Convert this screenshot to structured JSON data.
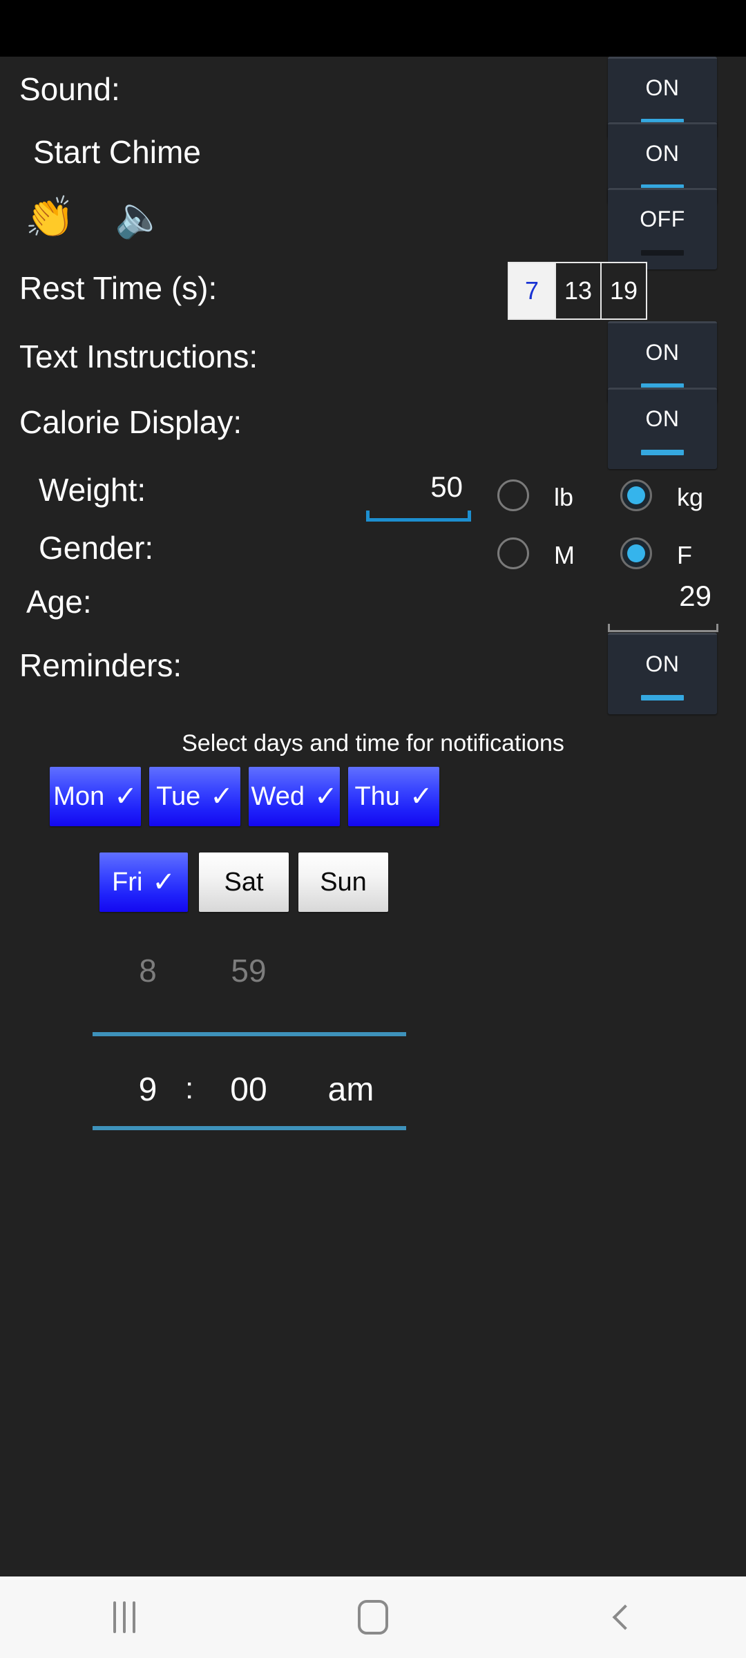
{
  "status_bar": {
    "background": "#000000"
  },
  "theme": {
    "background": "#222222",
    "accent_cyan": "#35a8e0",
    "accent_blue": "#1a34d4",
    "day_selected_blue": "#2a31fb",
    "text": "#ffffff"
  },
  "settings": {
    "sound": {
      "label": "Sound:",
      "toggle": "ON",
      "state": "on"
    },
    "start_chime": {
      "label": "Start Chime",
      "toggle": "ON",
      "state": "on"
    },
    "clap_sound": {
      "clap_icon": "clapping-hands-icon",
      "speaker_icon": "speaker-wave-icon",
      "toggle": "OFF",
      "state": "off"
    },
    "rest_time": {
      "label": "Rest Time (s):",
      "options": [
        "7",
        "13",
        "19"
      ],
      "selected": "7",
      "selected_index": 0
    },
    "text_instructions": {
      "label": "Text Instructions:",
      "toggle": "ON",
      "state": "on"
    },
    "calorie_display": {
      "label": "Calorie Display:",
      "toggle": "ON",
      "state": "on"
    },
    "weight": {
      "label": "Weight:",
      "value": "50",
      "placeholder": "0",
      "units": [
        {
          "label": "lb",
          "checked": false
        },
        {
          "label": "kg",
          "checked": true
        }
      ]
    },
    "gender": {
      "label": "Gender:",
      "options": [
        {
          "label": "M",
          "checked": false
        },
        {
          "label": "F",
          "checked": true
        }
      ]
    },
    "age": {
      "label": "Age:",
      "value": "29",
      "placeholder": "0"
    },
    "reminders": {
      "label": "Reminders:",
      "toggle": "ON",
      "state": "on",
      "hint": "Select days and time for notifications",
      "check_glyph": "✓",
      "days": [
        {
          "label": "Mon",
          "selected": true
        },
        {
          "label": "Tue",
          "selected": true
        },
        {
          "label": "Wed",
          "selected": true
        },
        {
          "label": "Thu",
          "selected": true
        },
        {
          "label": "Fri",
          "selected": true
        },
        {
          "label": "Sat",
          "selected": false
        },
        {
          "label": "Sun",
          "selected": false
        }
      ],
      "time": {
        "hour_ghost": "8",
        "hour": "9",
        "separator": ":",
        "minute_ghost": "59",
        "minute": "00",
        "meridiem_ghost": "",
        "meridiem": "am"
      }
    }
  },
  "nav_bar": {
    "recents": "recents-icon",
    "home": "home-icon",
    "back": "back-icon"
  }
}
